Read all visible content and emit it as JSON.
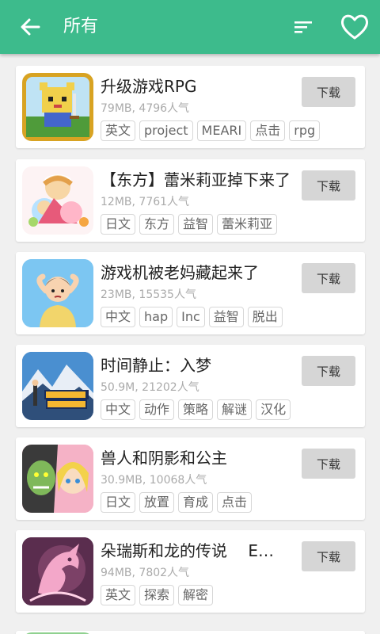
{
  "header": {
    "title": "所有",
    "back_icon": "arrow-left-icon",
    "sort_icon": "sort-icon",
    "favorite_icon": "heart-outline-icon",
    "bar_color": "#3dbb8c"
  },
  "games": [
    {
      "name": "升级游戏RPG",
      "size": "79MB",
      "popularity": "4796人气",
      "tags": [
        "英文",
        "project",
        "MEARI",
        "点击",
        "rpg"
      ],
      "download_label": "下载"
    },
    {
      "name": "【东方】蕾米莉亚掉下来了",
      "size": "12MB",
      "popularity": "7761人气",
      "tags": [
        "日文",
        "东方",
        "益智",
        "蕾米莉亚"
      ],
      "download_label": "下载"
    },
    {
      "name": "游戏机被老妈藏起来了",
      "size": "23MB",
      "popularity": "15535人气",
      "tags": [
        "中文",
        "hap",
        "Inc",
        "益智",
        "脱出"
      ],
      "download_label": "下载"
    },
    {
      "name": "时间静止：入梦",
      "size": "50.9M",
      "popularity": "21202人气",
      "tags": [
        "中文",
        "动作",
        "策略",
        "解谜",
        "汉化"
      ],
      "download_label": "下载"
    },
    {
      "name": "兽人和阴影和公主",
      "size": "30.9MB",
      "popularity": "10068人气",
      "tags": [
        "日文",
        "放置",
        "育成",
        "点击"
      ],
      "download_label": "下载"
    },
    {
      "name": "朵瑞斯和龙的传说　 E…",
      "size": "94MB",
      "popularity": "7802人气",
      "tags": [
        "英文",
        "探索",
        "解密"
      ],
      "download_label": "下载"
    }
  ],
  "thumb_art": [
    "cat-knight-pixel-art",
    "flandre-remilia-art",
    "boy-hands-on-head-art",
    "time-stopper-mountain-art",
    "orc-princess-art",
    "pink-dragon-art"
  ]
}
